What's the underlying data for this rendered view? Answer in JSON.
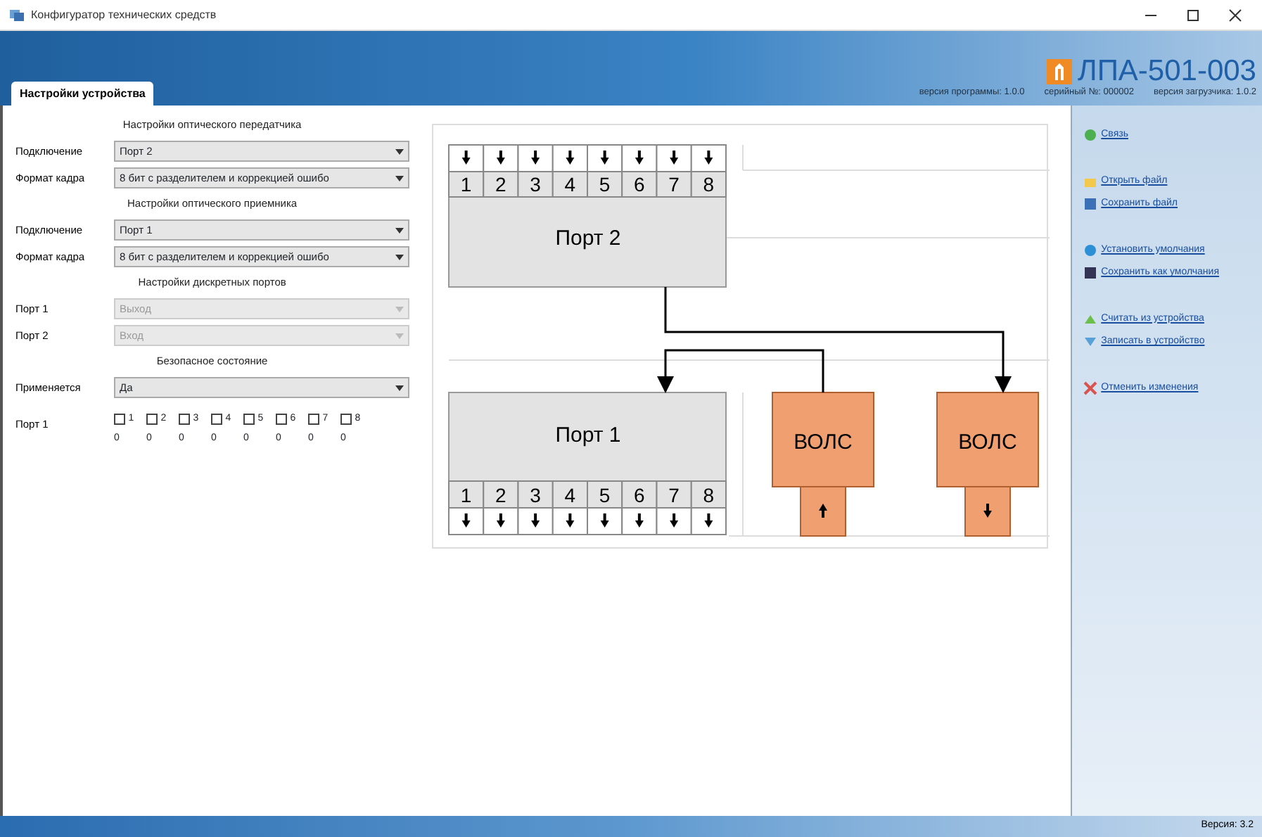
{
  "window": {
    "title": "Конфигуратор технических средств"
  },
  "header": {
    "product": "ЛПА-501-003",
    "info": [
      "версия программы: 1.0.0",
      "серийный №: 000002",
      "версия загрузчика: 1.0.2"
    ]
  },
  "tabs": [
    {
      "label": "Настройки устройства",
      "selected": true
    }
  ],
  "settings": [
    {
      "kind": "heading",
      "text": "Настройки оптического передатчика"
    },
    {
      "kind": "select",
      "label": "Подключение",
      "value": "Порт 2",
      "disabled": false
    },
    {
      "kind": "select",
      "label": "Формат кадра",
      "value": "8 бит с разделителем и коррекцией ошибо",
      "disabled": false
    },
    {
      "kind": "heading",
      "text": "Настройки оптического приемника"
    },
    {
      "kind": "select",
      "label": "Подключение",
      "value": "Порт 1",
      "disabled": false
    },
    {
      "kind": "select",
      "label": "Формат кадра",
      "value": "8 бит с разделителем и коррекцией ошибо",
      "disabled": false
    },
    {
      "kind": "heading",
      "text": "Настройки дискретных портов"
    },
    {
      "kind": "select",
      "label": "Порт 1",
      "value": "Выход",
      "disabled": true
    },
    {
      "kind": "select",
      "label": "Порт 2",
      "value": "Вход",
      "disabled": true
    },
    {
      "kind": "heading",
      "text": "Безопасное состояние"
    },
    {
      "kind": "select",
      "label": "Применяется",
      "value": "Да",
      "disabled": false
    },
    {
      "kind": "checks",
      "label": "Порт 1",
      "items": [
        {
          "label": "1",
          "checked": false,
          "value": "0"
        },
        {
          "label": "2",
          "checked": false,
          "value": "0"
        },
        {
          "label": "3",
          "checked": false,
          "value": "0"
        },
        {
          "label": "4",
          "checked": false,
          "value": "0"
        },
        {
          "label": "5",
          "checked": false,
          "value": "0"
        },
        {
          "label": "6",
          "checked": false,
          "value": "0"
        },
        {
          "label": "7",
          "checked": false,
          "value": "0"
        },
        {
          "label": "8",
          "checked": false,
          "value": "0"
        }
      ]
    }
  ],
  "diagram": {
    "port_out": {
      "label": "Порт 2",
      "cells": [
        "1",
        "2",
        "3",
        "4",
        "5",
        "6",
        "7",
        "8"
      ]
    },
    "port_in": {
      "label": "Порт 1",
      "cells": [
        "1",
        "2",
        "3",
        "4",
        "5",
        "6",
        "7",
        "8"
      ]
    },
    "fiber": [
      {
        "label": "ВОЛС"
      },
      {
        "label": "ВОЛС"
      }
    ]
  },
  "sidebar": {
    "groups": [
      [
        {
          "label": "Связь"
        }
      ],
      [
        {
          "label": "Открыть файл"
        },
        {
          "label": "Сохранить файл"
        }
      ],
      [
        {
          "label": "Установить умолчания"
        },
        {
          "label": "Сохранить как умолчания"
        }
      ],
      [
        {
          "label": "Считать из устройства"
        },
        {
          "label": "Записать в устройство"
        }
      ],
      [
        {
          "label": "Отменить изменения"
        }
      ]
    ]
  },
  "status_bar": {
    "version": "Версия: 3.2"
  }
}
